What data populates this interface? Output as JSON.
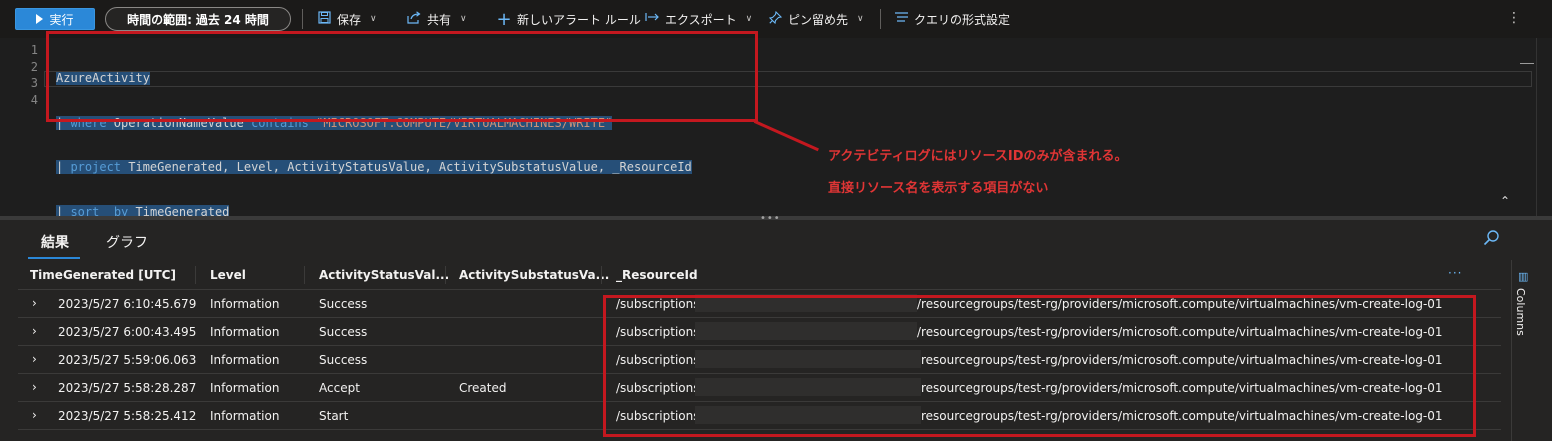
{
  "toolbar": {
    "run_label": "実行",
    "time_range_label": "時間の範囲:",
    "time_range_value": "過去 24 時間",
    "save_label": "保存",
    "share_label": "共有",
    "new_alert_label": "新しいアラート ルール",
    "export_label": "エクスポート",
    "pin_label": "ピン留め先",
    "format_label": "クエリの形式設定",
    "more_label": "⋮"
  },
  "editor": {
    "line_numbers": [
      "1",
      "2",
      "3",
      "4"
    ],
    "lines": [
      {
        "table": "AzureActivity"
      },
      {
        "pipe": "| ",
        "kw1": "where",
        "text1": " OperationNameValue ",
        "kw2": "contains",
        "text2": " ",
        "str": "\"MICROSOFT.COMPUTE/VIRTUALMACHINES/WRITE\""
      },
      {
        "pipe": "| ",
        "kw1": "project",
        "text1": " TimeGenerated, Level, ActivityStatusValue, ActivitySubstatusValue, _ResourceId"
      },
      {
        "pipe": "| ",
        "kw1": "sort",
        "text1": "  ",
        "kw2": "by",
        "text2": " TimeGenerated"
      }
    ]
  },
  "annotation": {
    "line1": "アクテビティログにはリソースIDのみが含まれる。",
    "line2": "直接リソース名を表示する項目がない"
  },
  "results": {
    "tabs": [
      "結果",
      "グラフ"
    ],
    "columns": [
      "TimeGenerated [UTC]",
      "Level",
      "ActivityStatusVal...",
      "ActivitySubstatusVa...",
      "_ResourceId"
    ],
    "column_menu": "···",
    "side_panel_label": "Columns",
    "rows": [
      {
        "time": "2023/5/27 6:10:45.679",
        "level": "Information",
        "status": "Success",
        "substatus": "",
        "rid_prefix": "/subscriptions/",
        "rid_suffix": "/resourcegroups/test-rg/providers/microsoft.compute/virtualmachines/vm-create-log-01"
      },
      {
        "time": "2023/5/27 6:00:43.495",
        "level": "Information",
        "status": "Success",
        "substatus": "",
        "rid_prefix": "/subscriptions/",
        "rid_suffix": "/resourcegroups/test-rg/providers/microsoft.compute/virtualmachines/vm-create-log-01"
      },
      {
        "time": "2023/5/27 5:59:06.063",
        "level": "Information",
        "status": "Success",
        "substatus": "",
        "rid_prefix": "/subscriptions/",
        "rid_suffix": "resourcegroups/test-rg/providers/microsoft.compute/virtualmachines/vm-create-log-01"
      },
      {
        "time": "2023/5/27 5:58:28.287",
        "level": "Information",
        "status": "Accept",
        "substatus": "Created",
        "rid_prefix": "/subscriptions/",
        "rid_suffix": "resourcegroups/test-rg/providers/microsoft.compute/virtualmachines/vm-create-log-01"
      },
      {
        "time": "2023/5/27 5:58:25.412",
        "level": "Information",
        "status": "Start",
        "substatus": "",
        "rid_prefix": "/subscriptions/",
        "rid_suffix": "resourcegroups/test-rg/providers/microsoft.compute/virtualmachines/vm-create-log-01"
      }
    ]
  },
  "colors": {
    "accent": "#2b88d8",
    "annotation_red": "#c4181f"
  }
}
